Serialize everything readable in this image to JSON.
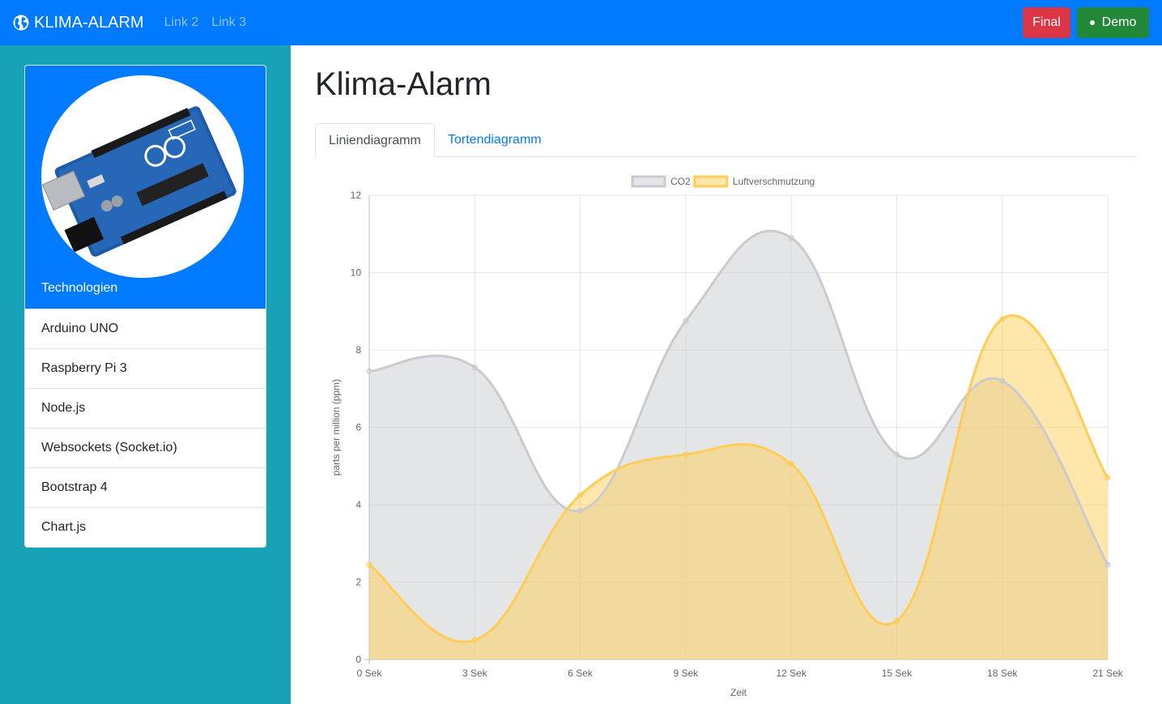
{
  "navbar": {
    "brand": "KLIMA-ALARM",
    "brand_icon": "globe-icon",
    "links": [
      "Link 2",
      "Link 3"
    ],
    "buttons": {
      "final": "Final",
      "demo": "Demo"
    },
    "colors": {
      "bar": "#007bff",
      "final": "#dc3545",
      "demo": "#218838"
    }
  },
  "sidebar": {
    "image": "arduino-uno-board",
    "card_title": "Technologien",
    "items": [
      "Arduino UNO",
      "Raspberry Pi 3",
      "Node.js",
      "Websockets (Socket.io)",
      "Bootstrap 4",
      "Chart.js"
    ]
  },
  "main": {
    "title": "Klima-Alarm",
    "tabs": [
      {
        "label": "Liniendiagramm",
        "active": true
      },
      {
        "label": "Tortendiagramm",
        "active": false
      }
    ]
  },
  "chart_data": {
    "type": "line",
    "categories": [
      "0 Sek",
      "3 Sek",
      "6 Sek",
      "9 Sek",
      "12 Sek",
      "15 Sek",
      "18 Sek",
      "21 Sek"
    ],
    "series": [
      {
        "name": "CO2",
        "values": [
          7.45,
          7.55,
          3.85,
          8.75,
          10.9,
          5.3,
          7.2,
          2.45
        ],
        "color": "#c9cbcf",
        "fill": "rgba(201,203,207,0.5)"
      },
      {
        "name": "Luftverschmutzung",
        "values": [
          2.45,
          0.5,
          4.25,
          5.3,
          5.05,
          1.0,
          8.8,
          4.7
        ],
        "color": "#ffcd56",
        "fill": "rgba(255,205,86,0.5)"
      }
    ],
    "xlabel": "Zeit",
    "ylabel": "parts per million (ppm)",
    "ylim": [
      0,
      12
    ],
    "yticks": [
      0,
      2,
      4,
      6,
      8,
      10,
      12
    ],
    "grid": true,
    "legend": "top"
  }
}
